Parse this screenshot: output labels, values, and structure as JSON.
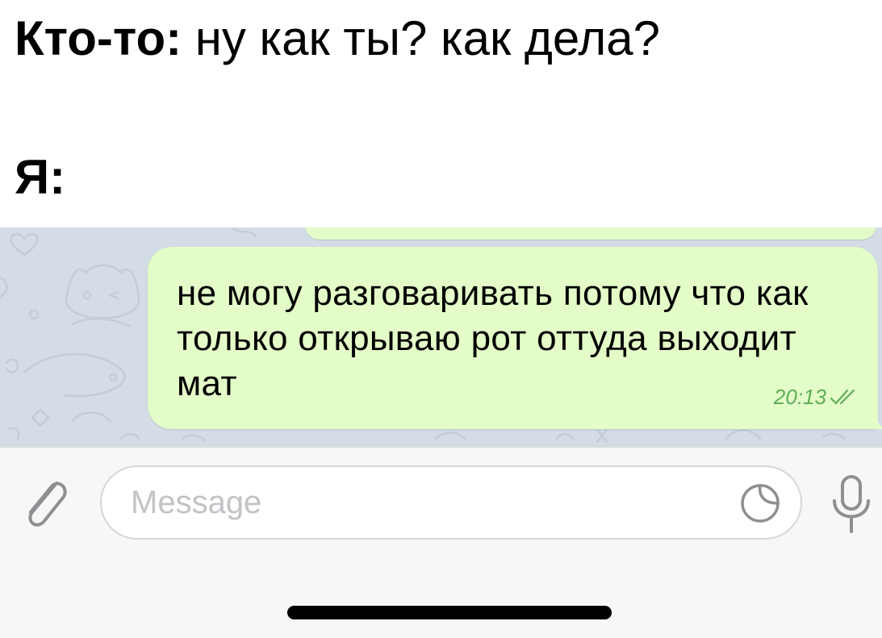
{
  "meme": {
    "line1_speaker": "Кто-то:",
    "line1_text": " ну как ты? как дела?",
    "line2_speaker": "Я:"
  },
  "chat": {
    "message_text": "не могу разговаривать потому что как только открываю рот оттуда выходит мат",
    "message_time": "20:13",
    "bubble_color": "#e3fcc8",
    "background_color": "#d4dde6",
    "read_status_icon": "double-check-icon"
  },
  "input": {
    "placeholder": "Message",
    "attach_icon": "paperclip-icon",
    "sticker_icon": "sticker-icon",
    "mic_icon": "microphone-icon"
  }
}
